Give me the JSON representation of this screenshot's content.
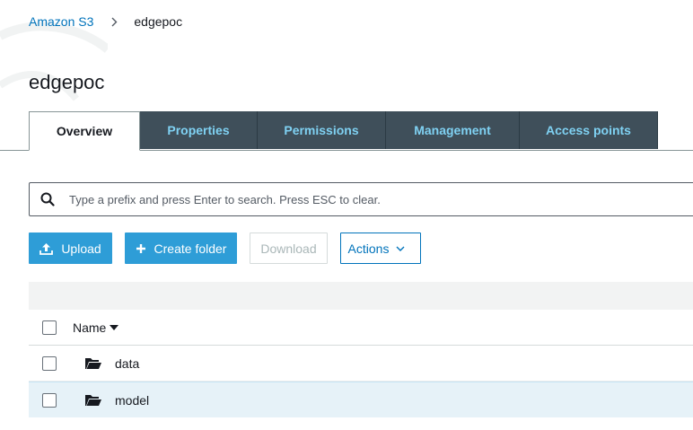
{
  "breadcrumb": {
    "root": "Amazon S3",
    "current": "edgepoc"
  },
  "page": {
    "title": "edgepoc"
  },
  "tabs": [
    {
      "label": "Overview",
      "active": true
    },
    {
      "label": "Properties",
      "active": false
    },
    {
      "label": "Permissions",
      "active": false
    },
    {
      "label": "Management",
      "active": false
    },
    {
      "label": "Access points",
      "active": false
    }
  ],
  "search": {
    "placeholder": "Type a prefix and press Enter to search. Press ESC to clear.",
    "icon": "search-icon"
  },
  "toolbar": {
    "upload_label": "Upload",
    "create_folder_label": "Create folder",
    "download_label": "Download",
    "actions_label": "Actions"
  },
  "table": {
    "columns": [
      "Name"
    ],
    "rows": [
      {
        "name": "data",
        "icon": "folder-open-icon"
      },
      {
        "name": "model",
        "icon": "folder-open-icon"
      }
    ]
  },
  "colors": {
    "link": "#0073bb",
    "primary": "#2e9dd7",
    "tab_bg": "#3f4f5a",
    "tab_text": "#7fd1f2",
    "row_selected": "#e6f2f8"
  }
}
